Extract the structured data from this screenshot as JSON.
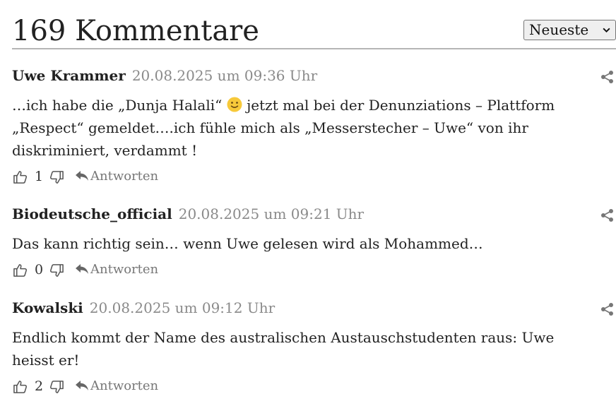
{
  "header": {
    "title": "169 Kommentare",
    "sort_selected": "Neueste"
  },
  "colors": {
    "text": "#222222",
    "meta": "#8a8a8a",
    "action": "#777777",
    "divider": "#b5b5b5"
  },
  "comments": [
    {
      "author": "Uwe Krammer",
      "date": "20.08.2025 um 09:36 Uhr",
      "text_before_emoji": "…ich habe die „Dunja Halali“ ",
      "emoji": "slightly-smiling-face-icon",
      "text_after_emoji": " jetzt mal bei der Denunziations – Plattform „Respect“ gemeldet….ich fühle mich als „Messerstecher – Uwe“ von ihr diskriminiert, verdammt !",
      "likes": "1",
      "reply_label": "Antworten"
    },
    {
      "author": "Biodeutsche_official",
      "date": "20.08.2025 um 09:21 Uhr",
      "text": "Das kann richtig sein… wenn Uwe gelesen wird als Mohammed…",
      "likes": "0",
      "reply_label": "Antworten"
    },
    {
      "author": "Kowalski",
      "date": "20.08.2025 um 09:12 Uhr",
      "text": "Endlich kommt der Name des australischen Austauschstudenten raus: Uwe heisst er!",
      "likes": "2",
      "reply_label": "Antworten"
    }
  ]
}
